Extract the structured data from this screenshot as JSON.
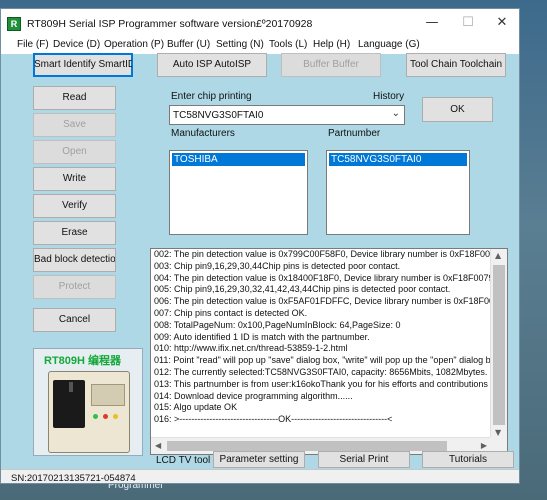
{
  "window": {
    "title": "RT809H Serial ISP Programmer software version£º20170928",
    "controls": {
      "minimize": "—",
      "maximize": "☐",
      "close": "✕"
    }
  },
  "menu": [
    "File (F)",
    "Device (D)",
    "Operation (P)",
    "Buffer (U)",
    "Setting (N)",
    "Tools (L)",
    "Help (H)",
    "Language (G)"
  ],
  "toolbar": {
    "smart_identify": "Smart Identify SmartID",
    "auto_isp": "Auto ISP AutoISP",
    "buffer": "Buffer Buffer",
    "tool_chain": "Tool Chain Toolchain"
  },
  "side_buttons": {
    "read": "Read",
    "save": "Save",
    "open": "Open",
    "write": "Write",
    "verify": "Verify",
    "erase": "Erase",
    "bad_block": "Bad block detection l",
    "protect": "Protect",
    "cancel": "Cancel"
  },
  "chip": {
    "enter_label": "Enter chip printing",
    "history_label": "History",
    "value": "TC58NVG3S0FTAI0",
    "ok": "OK"
  },
  "manufacturers": {
    "label": "Manufacturers",
    "selected": "TOSHIBA"
  },
  "partnumber": {
    "label": "Partnumber",
    "selected": "TC58NVG3S0FTAI0"
  },
  "log": [
    "002:  The pin detection value is 0x799C00F58F0, Device library number is 0xF18F00079",
    "003:  Chip pin9,16,29,30,44Chip pins is detected poor contact.",
    "004:  The pin detection value is 0x18400F18F0, Device library number is 0xF18F007990",
    "005:  Chip pin9,16,29,30,32,41,42,43,44Chip pins is detected poor contact.",
    "006:  The pin detection value is 0xF5AF01FDFFC, Device library number is 0xF18F0079",
    "007:  Chip pins contact is detected OK.",
    "008:  TotalPageNum: 0x100,PageNumInBlock: 64,PageSize: 0",
    "009:  Auto identified 1 ID is match with the partnumber.",
    "010:  http://www.ifix.net.cn/thread-53859-1-2.html",
    "011:  Point \"read\" will pop up \"save\" dialog box, \"write\" will pop up the \"open\" dialog box",
    "012:  The currently selected:TC58NVG3S0FTAI0, capacity: 8656Mbits, 1082Mbytes.",
    "013:  This partnumber is from user:k16okoThank you for his efforts and contributions on",
    "014:  Download device programming algorithm......",
    "015:  Algo update OK",
    "016:  >---------------------------------OK--------------------------------<"
  ],
  "bottom": {
    "lcd_tv_tool": "LCD TV tool",
    "parameter_setting": "Parameter setting",
    "serial_print": "Serial Print",
    "tutorials": "Tutorials"
  },
  "product": {
    "title": "RT809H 编程器"
  },
  "status": {
    "serial": "SN:20170213135721-054874"
  },
  "desktop": {
    "left_text": "D",
    "bottom_text": "Programmer"
  }
}
